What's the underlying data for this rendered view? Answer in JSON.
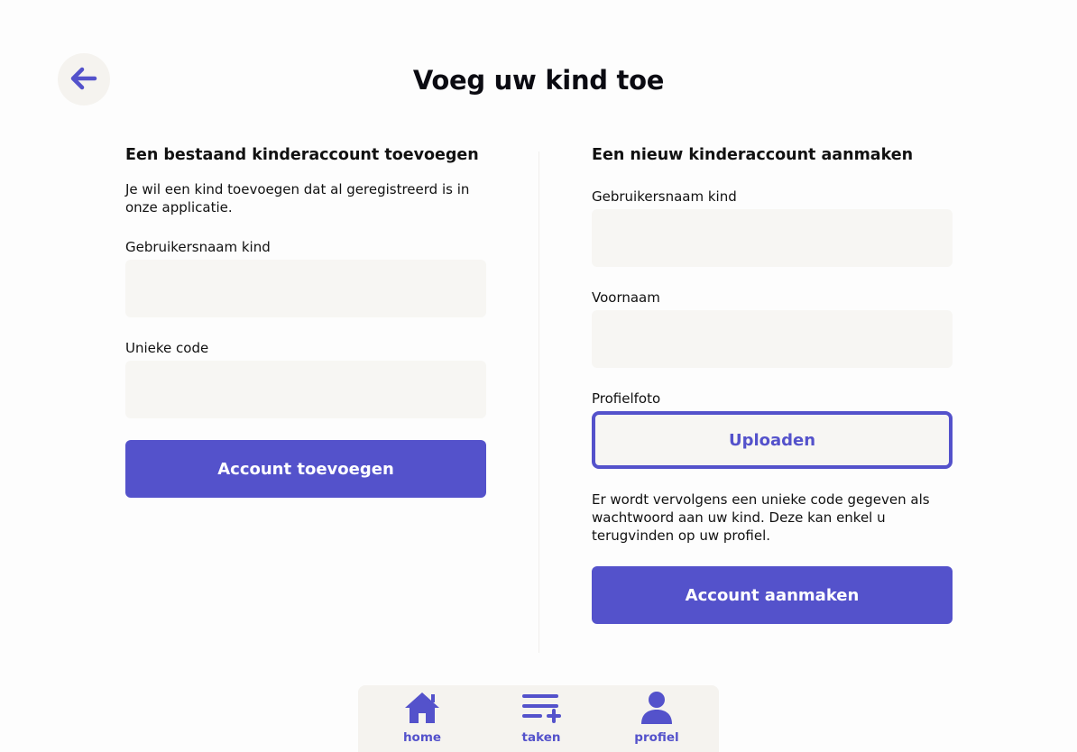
{
  "header": {
    "title": "Voeg uw kind toe",
    "back_icon": "arrow-left-icon"
  },
  "colors": {
    "accent": "#5452cb",
    "input_bg": "#f7f6f3",
    "nav_bg": "#f5f3ef"
  },
  "left": {
    "title": "Een bestaand kinderaccount toevoegen",
    "description_line1": "Je wil een kind toevoegen dat al geregistreerd is in",
    "description_line2": "onze applicatie.",
    "username_label": "Gebruikersnaam kind",
    "username_value": "",
    "code_label": "Unieke code",
    "code_value": "",
    "submit_label": "Account toevoegen"
  },
  "right": {
    "title": "Een nieuw kinderaccount aanmaken",
    "username_label": "Gebruikersnaam kind",
    "username_value": "",
    "firstname_label": "Voornaam",
    "firstname_value": "",
    "photo_label": "Profielfoto",
    "upload_label": "Uploaden",
    "info_line1": "Er wordt vervolgens een unieke code gegeven als",
    "info_line2": "wachtwoord aan uw kind. Deze kan enkel u",
    "info_line3": "terugvinden op uw profiel.",
    "submit_label": "Account aanmaken"
  },
  "nav": {
    "items": [
      {
        "label": "home",
        "icon": "home-icon"
      },
      {
        "label": "taken",
        "icon": "task-add-icon"
      },
      {
        "label": "profiel",
        "icon": "user-icon"
      }
    ]
  }
}
